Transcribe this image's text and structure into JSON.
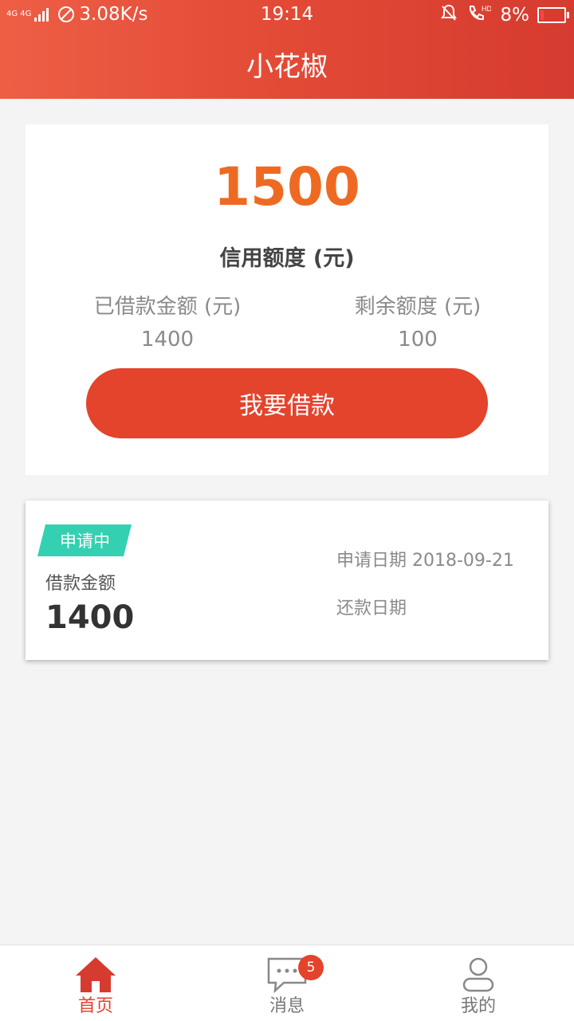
{
  "status_bar": {
    "network": "4G 4G",
    "speed": "3.08K/s",
    "time": "19:14",
    "hd": "HD",
    "battery": "8%"
  },
  "header": {
    "title": "小花椒"
  },
  "credit": {
    "amount": "1500",
    "amount_label": "信用额度 (元)",
    "borrowed_label": "已借款金额 (元)",
    "borrowed_value": "1400",
    "remaining_label": "剩余额度 (元)",
    "remaining_value": "100",
    "borrow_button": "我要借款"
  },
  "loan": {
    "status": "申请中",
    "amount_label": "借款金额",
    "amount": "1400",
    "apply_date": "申请日期 2018-09-21",
    "repay_date": "还款日期"
  },
  "nav": {
    "items": [
      {
        "label": "首页",
        "icon": "home-icon",
        "active": true
      },
      {
        "label": "消息",
        "icon": "message-icon",
        "badge": "5"
      },
      {
        "label": "我的",
        "icon": "user-icon"
      }
    ]
  },
  "colors": {
    "header_start": "#ee5e45",
    "header_end": "#d63b2f",
    "accent": "#e4432c",
    "amount": "#ee6a22",
    "status_badge": "#33d1b1"
  }
}
